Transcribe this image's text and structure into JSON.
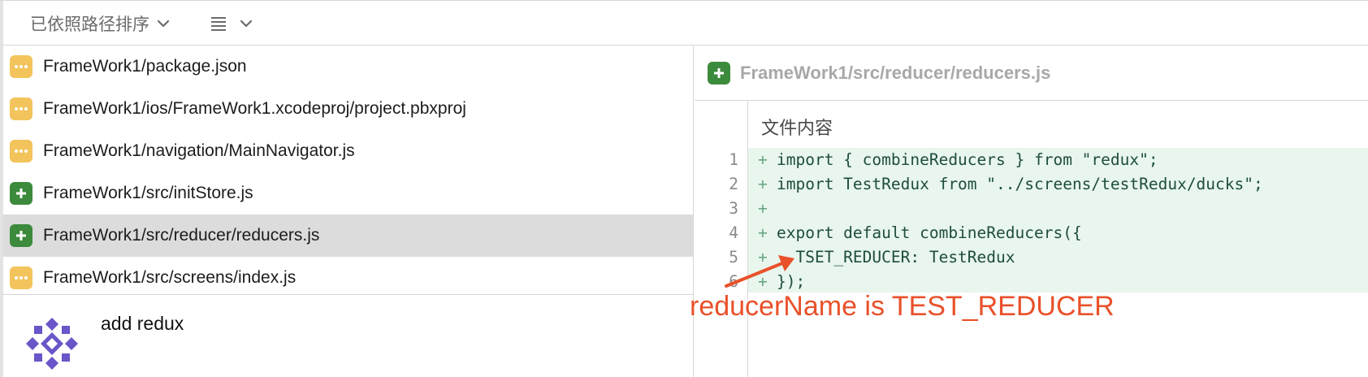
{
  "toolbar": {
    "sort_label": "已依照路径排序",
    "sort_icon": "chevron-down-icon",
    "view_icon": "list-icon"
  },
  "file_list": [
    {
      "path": "FrameWork1/package.json",
      "status": "modified",
      "selected": false
    },
    {
      "path": "FrameWork1/ios/FrameWork1.xcodeproj/project.pbxproj",
      "status": "modified",
      "selected": false
    },
    {
      "path": "FrameWork1/navigation/MainNavigator.js",
      "status": "modified",
      "selected": false
    },
    {
      "path": "FrameWork1/src/initStore.js",
      "status": "added",
      "selected": false
    },
    {
      "path": "FrameWork1/src/reducer/reducers.js",
      "status": "added",
      "selected": true
    },
    {
      "path": "FrameWork1/src/screens/index.js",
      "status": "modified",
      "selected": false
    }
  ],
  "commit": {
    "message": "add redux",
    "avatar": "avatar-identicon"
  },
  "diff": {
    "file_title": "FrameWork1/src/reducer/reducers.js",
    "content_label": "文件内容",
    "lines": [
      {
        "num": "1",
        "marker": "+",
        "code": "import { combineReducers } from \"redux\";"
      },
      {
        "num": "2",
        "marker": "+",
        "code": "import TestRedux from \"../screens/testRedux/ducks\";"
      },
      {
        "num": "3",
        "marker": "+",
        "code": ""
      },
      {
        "num": "4",
        "marker": "+",
        "code": "export default combineReducers({"
      },
      {
        "num": "5",
        "marker": "+",
        "code": "  TSET_REDUCER: TestRedux"
      },
      {
        "num": "6",
        "marker": "+",
        "code": "});"
      }
    ]
  },
  "annotation": {
    "text": "reducerName is TEST_REDUCER",
    "color": "#e9512a"
  },
  "colors": {
    "modified_badge": "#f2c45b",
    "added_badge": "#3c8a3c",
    "added_line_bg": "#e8f6ee",
    "selected_row": "#dcdcdc"
  }
}
